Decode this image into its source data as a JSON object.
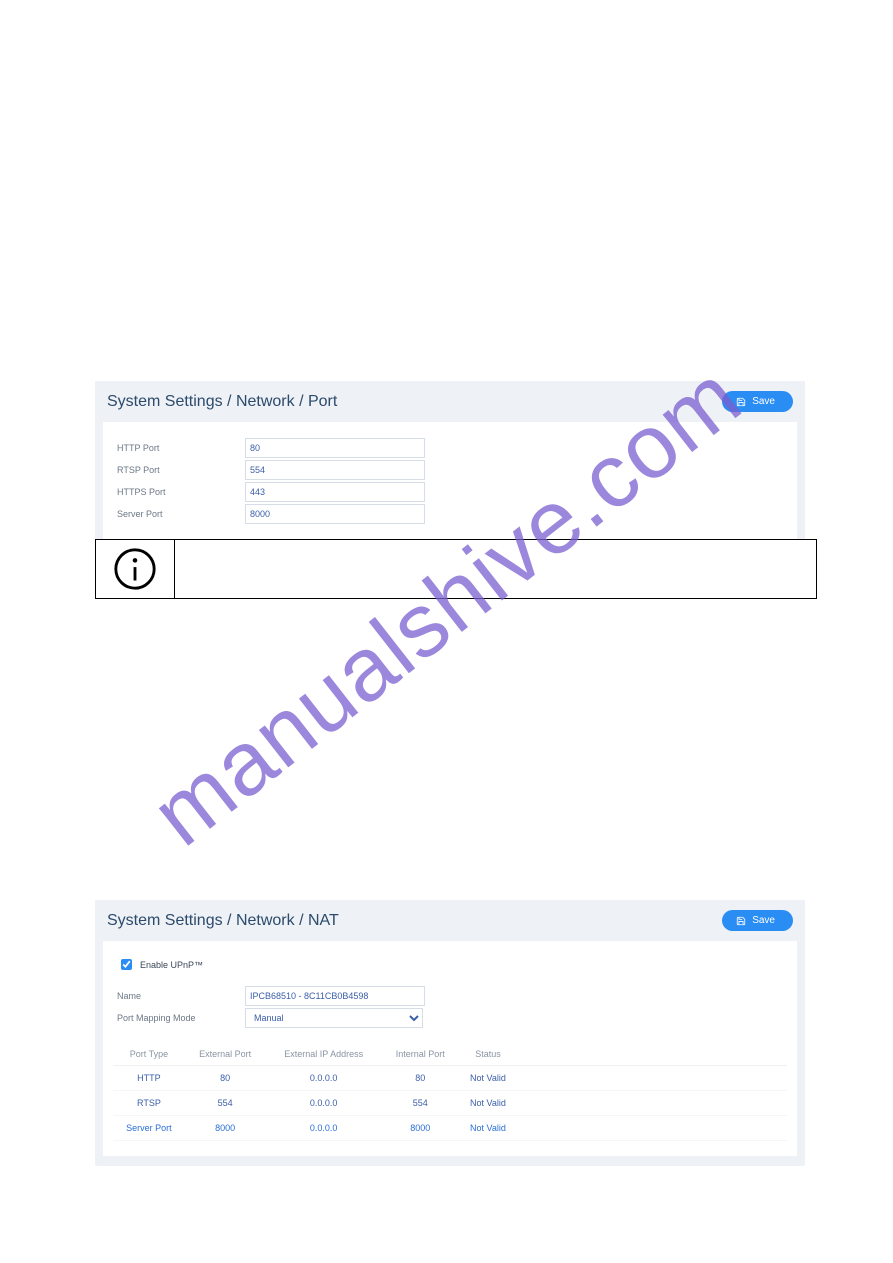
{
  "watermark": "manualshive.com",
  "port_panel": {
    "breadcrumb": "System Settings / Network / Port",
    "save_label": "Save",
    "fields": [
      {
        "label": "HTTP Port",
        "value": "80"
      },
      {
        "label": "RTSP Port",
        "value": "554"
      },
      {
        "label": "HTTPS Port",
        "value": "443"
      },
      {
        "label": "Server Port",
        "value": "8000"
      }
    ]
  },
  "nat_panel": {
    "breadcrumb": "System Settings / Network / NAT",
    "save_label": "Save",
    "enable_label": "Enable UPnP™",
    "enable_checked": true,
    "name_label": "Name",
    "name_value": "IPCB68510 - 8C11CB0B4598",
    "mode_label": "Port Mapping Mode",
    "mode_value": "Manual",
    "table": {
      "headers": [
        "Port Type",
        "External Port",
        "External IP Address",
        "Internal Port",
        "Status"
      ],
      "rows": [
        {
          "type": "HTTP",
          "ext_port": "80",
          "ext_ip": "0.0.0.0",
          "int_port": "80",
          "status": "Not Valid"
        },
        {
          "type": "RTSP",
          "ext_port": "554",
          "ext_ip": "0.0.0.0",
          "int_port": "554",
          "status": "Not Valid"
        },
        {
          "type": "Server Port",
          "ext_port": "8000",
          "ext_ip": "0.0.0.0",
          "int_port": "8000",
          "status": "Not Valid"
        }
      ]
    }
  }
}
